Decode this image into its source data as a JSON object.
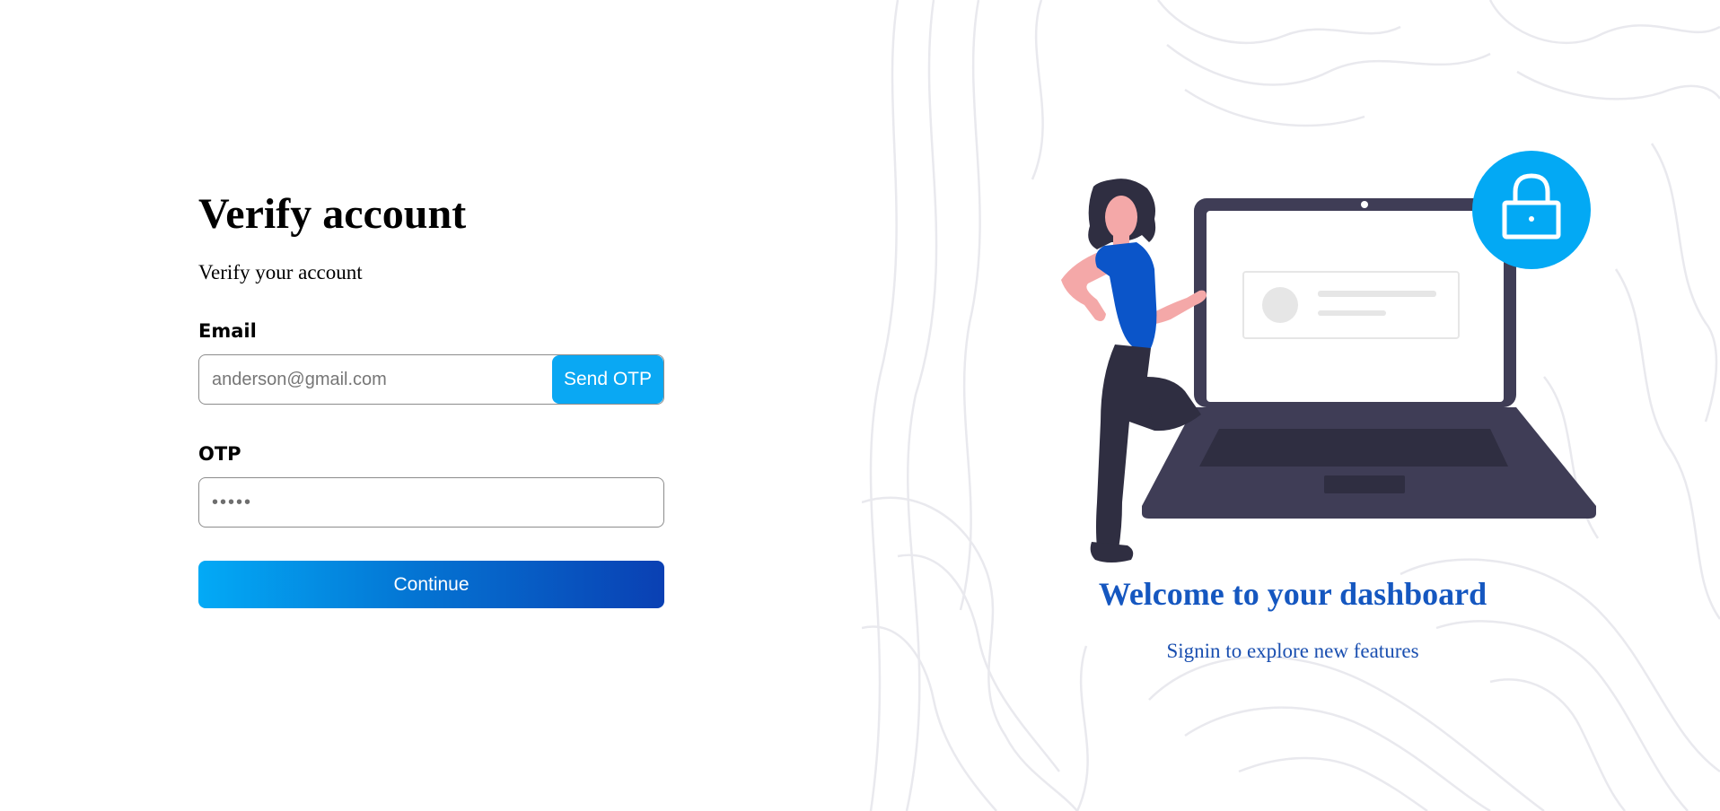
{
  "form": {
    "title": "Verify account",
    "subtitle": "Verify your account",
    "email_label": "Email",
    "email_placeholder": "anderson@gmail.com",
    "send_otp_label": "Send OTP",
    "otp_label": "OTP",
    "otp_placeholder": "•••••",
    "continue_label": "Continue"
  },
  "hero": {
    "title": "Welcome to your dashboard",
    "subtitle": "Signin to explore new features",
    "icons": [
      "lock-icon",
      "woman-illustration",
      "laptop-illustration"
    ]
  },
  "colors": {
    "accent": "#0aa8f3",
    "gradient_start": "#03aaf6",
    "gradient_end": "#0a40b3",
    "heading_blue": "#1557c0",
    "laptop_dark": "#3f3d56",
    "shirt_blue": "#0b55c9",
    "skin": "#f4a8a8"
  }
}
